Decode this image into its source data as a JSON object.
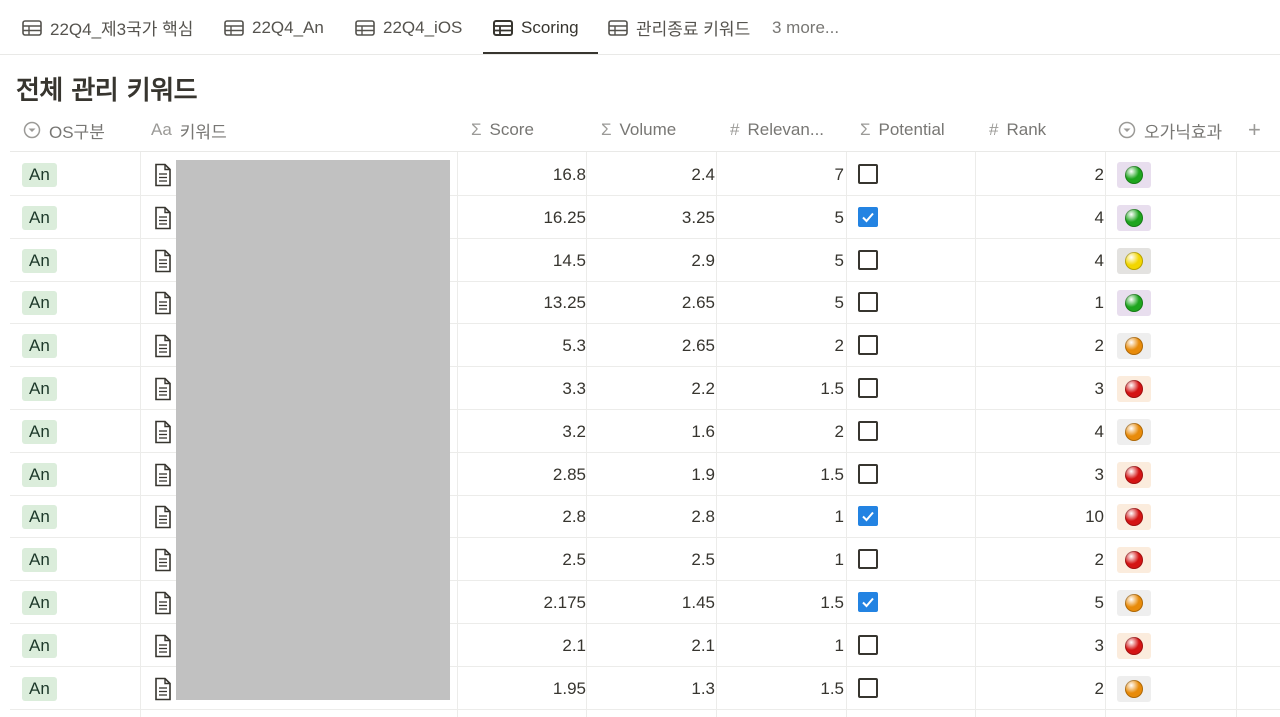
{
  "tabs": [
    {
      "label": "22Q4_제3국가 핵심",
      "active": false
    },
    {
      "label": "22Q4_An",
      "active": false
    },
    {
      "label": "22Q4_iOS",
      "active": false
    },
    {
      "label": "Scoring",
      "active": true
    },
    {
      "label": "관리종료 키워드",
      "active": false
    }
  ],
  "more_tabs": "3 more...",
  "title": "전체 관리 키워드",
  "columns": [
    {
      "label": "OS구분",
      "icon": "select-icon"
    },
    {
      "label": "키워드",
      "icon": "title-icon"
    },
    {
      "label": "Score",
      "icon": "formula-icon"
    },
    {
      "label": "Volume",
      "icon": "formula-icon"
    },
    {
      "label": "Relevan...",
      "icon": "number-icon"
    },
    {
      "label": "Potential",
      "icon": "formula-icon"
    },
    {
      "label": "Rank",
      "icon": "number-icon"
    },
    {
      "label": "오가닉효과",
      "icon": "select-icon"
    }
  ],
  "icon_text": {
    "title": "Aa",
    "formula": "Σ",
    "number": "#"
  },
  "colors": {
    "green": "#1ea51e",
    "yellow": "#f2d600",
    "orange": "#e88b0a",
    "red": "#d41414",
    "checkbox_blue": "#2383e2",
    "tag_green_bg": "#dbeddb"
  },
  "rows": [
    {
      "os": "An",
      "score": "16.8",
      "volume": "2.4",
      "relevance": "7",
      "potential": false,
      "rank": "2",
      "effect": "green"
    },
    {
      "os": "An",
      "score": "16.25",
      "volume": "3.25",
      "relevance": "5",
      "potential": true,
      "rank": "4",
      "effect": "green"
    },
    {
      "os": "An",
      "score": "14.5",
      "volume": "2.9",
      "relevance": "5",
      "potential": false,
      "rank": "4",
      "effect": "yellow"
    },
    {
      "os": "An",
      "score": "13.25",
      "volume": "2.65",
      "relevance": "5",
      "potential": false,
      "rank": "1",
      "effect": "green"
    },
    {
      "os": "An",
      "score": "5.3",
      "volume": "2.65",
      "relevance": "2",
      "potential": false,
      "rank": "2",
      "effect": "orange"
    },
    {
      "os": "An",
      "score": "3.3",
      "volume": "2.2",
      "relevance": "1.5",
      "potential": false,
      "rank": "3",
      "effect": "red"
    },
    {
      "os": "An",
      "score": "3.2",
      "volume": "1.6",
      "relevance": "2",
      "potential": false,
      "rank": "4",
      "effect": "orange"
    },
    {
      "os": "An",
      "score": "2.85",
      "volume": "1.9",
      "relevance": "1.5",
      "potential": false,
      "rank": "3",
      "effect": "red"
    },
    {
      "os": "An",
      "score": "2.8",
      "volume": "2.8",
      "relevance": "1",
      "potential": true,
      "rank": "10",
      "effect": "red"
    },
    {
      "os": "An",
      "score": "2.5",
      "volume": "2.5",
      "relevance": "1",
      "potential": false,
      "rank": "2",
      "effect": "red"
    },
    {
      "os": "An",
      "score": "2.175",
      "volume": "1.45",
      "relevance": "1.5",
      "potential": true,
      "rank": "5",
      "effect": "orange"
    },
    {
      "os": "An",
      "score": "2.1",
      "volume": "2.1",
      "relevance": "1",
      "potential": false,
      "rank": "3",
      "effect": "red"
    },
    {
      "os": "An",
      "score": "1.95",
      "volume": "1.3",
      "relevance": "1.5",
      "potential": false,
      "rank": "2",
      "effect": "orange"
    }
  ]
}
